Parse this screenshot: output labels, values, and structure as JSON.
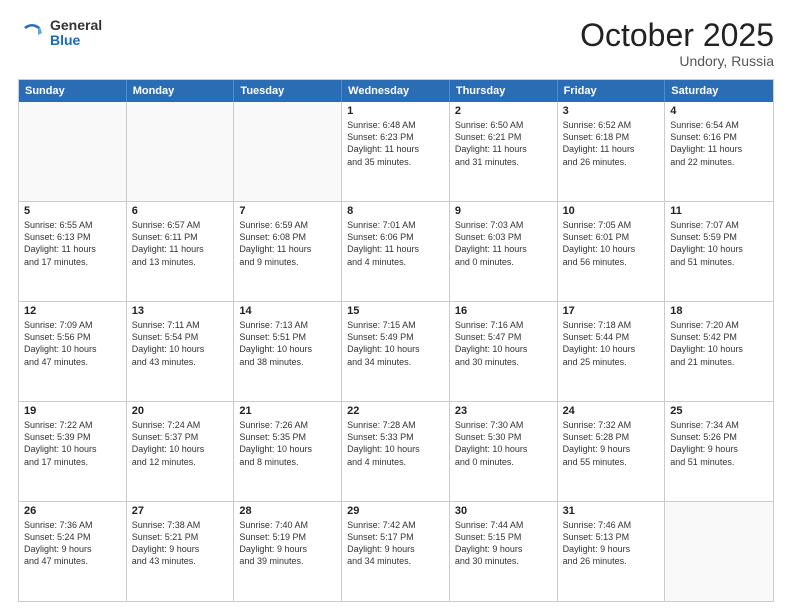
{
  "header": {
    "logo_general": "General",
    "logo_blue": "Blue",
    "month_title": "October 2025",
    "location": "Undory, Russia"
  },
  "weekdays": [
    "Sunday",
    "Monday",
    "Tuesday",
    "Wednesday",
    "Thursday",
    "Friday",
    "Saturday"
  ],
  "weeks": [
    [
      {
        "day": "",
        "text": ""
      },
      {
        "day": "",
        "text": ""
      },
      {
        "day": "",
        "text": ""
      },
      {
        "day": "1",
        "text": "Sunrise: 6:48 AM\nSunset: 6:23 PM\nDaylight: 11 hours\nand 35 minutes."
      },
      {
        "day": "2",
        "text": "Sunrise: 6:50 AM\nSunset: 6:21 PM\nDaylight: 11 hours\nand 31 minutes."
      },
      {
        "day": "3",
        "text": "Sunrise: 6:52 AM\nSunset: 6:18 PM\nDaylight: 11 hours\nand 26 minutes."
      },
      {
        "day": "4",
        "text": "Sunrise: 6:54 AM\nSunset: 6:16 PM\nDaylight: 11 hours\nand 22 minutes."
      }
    ],
    [
      {
        "day": "5",
        "text": "Sunrise: 6:55 AM\nSunset: 6:13 PM\nDaylight: 11 hours\nand 17 minutes."
      },
      {
        "day": "6",
        "text": "Sunrise: 6:57 AM\nSunset: 6:11 PM\nDaylight: 11 hours\nand 13 minutes."
      },
      {
        "day": "7",
        "text": "Sunrise: 6:59 AM\nSunset: 6:08 PM\nDaylight: 11 hours\nand 9 minutes."
      },
      {
        "day": "8",
        "text": "Sunrise: 7:01 AM\nSunset: 6:06 PM\nDaylight: 11 hours\nand 4 minutes."
      },
      {
        "day": "9",
        "text": "Sunrise: 7:03 AM\nSunset: 6:03 PM\nDaylight: 11 hours\nand 0 minutes."
      },
      {
        "day": "10",
        "text": "Sunrise: 7:05 AM\nSunset: 6:01 PM\nDaylight: 10 hours\nand 56 minutes."
      },
      {
        "day": "11",
        "text": "Sunrise: 7:07 AM\nSunset: 5:59 PM\nDaylight: 10 hours\nand 51 minutes."
      }
    ],
    [
      {
        "day": "12",
        "text": "Sunrise: 7:09 AM\nSunset: 5:56 PM\nDaylight: 10 hours\nand 47 minutes."
      },
      {
        "day": "13",
        "text": "Sunrise: 7:11 AM\nSunset: 5:54 PM\nDaylight: 10 hours\nand 43 minutes."
      },
      {
        "day": "14",
        "text": "Sunrise: 7:13 AM\nSunset: 5:51 PM\nDaylight: 10 hours\nand 38 minutes."
      },
      {
        "day": "15",
        "text": "Sunrise: 7:15 AM\nSunset: 5:49 PM\nDaylight: 10 hours\nand 34 minutes."
      },
      {
        "day": "16",
        "text": "Sunrise: 7:16 AM\nSunset: 5:47 PM\nDaylight: 10 hours\nand 30 minutes."
      },
      {
        "day": "17",
        "text": "Sunrise: 7:18 AM\nSunset: 5:44 PM\nDaylight: 10 hours\nand 25 minutes."
      },
      {
        "day": "18",
        "text": "Sunrise: 7:20 AM\nSunset: 5:42 PM\nDaylight: 10 hours\nand 21 minutes."
      }
    ],
    [
      {
        "day": "19",
        "text": "Sunrise: 7:22 AM\nSunset: 5:39 PM\nDaylight: 10 hours\nand 17 minutes."
      },
      {
        "day": "20",
        "text": "Sunrise: 7:24 AM\nSunset: 5:37 PM\nDaylight: 10 hours\nand 12 minutes."
      },
      {
        "day": "21",
        "text": "Sunrise: 7:26 AM\nSunset: 5:35 PM\nDaylight: 10 hours\nand 8 minutes."
      },
      {
        "day": "22",
        "text": "Sunrise: 7:28 AM\nSunset: 5:33 PM\nDaylight: 10 hours\nand 4 minutes."
      },
      {
        "day": "23",
        "text": "Sunrise: 7:30 AM\nSunset: 5:30 PM\nDaylight: 10 hours\nand 0 minutes."
      },
      {
        "day": "24",
        "text": "Sunrise: 7:32 AM\nSunset: 5:28 PM\nDaylight: 9 hours\nand 55 minutes."
      },
      {
        "day": "25",
        "text": "Sunrise: 7:34 AM\nSunset: 5:26 PM\nDaylight: 9 hours\nand 51 minutes."
      }
    ],
    [
      {
        "day": "26",
        "text": "Sunrise: 7:36 AM\nSunset: 5:24 PM\nDaylight: 9 hours\nand 47 minutes."
      },
      {
        "day": "27",
        "text": "Sunrise: 7:38 AM\nSunset: 5:21 PM\nDaylight: 9 hours\nand 43 minutes."
      },
      {
        "day": "28",
        "text": "Sunrise: 7:40 AM\nSunset: 5:19 PM\nDaylight: 9 hours\nand 39 minutes."
      },
      {
        "day": "29",
        "text": "Sunrise: 7:42 AM\nSunset: 5:17 PM\nDaylight: 9 hours\nand 34 minutes."
      },
      {
        "day": "30",
        "text": "Sunrise: 7:44 AM\nSunset: 5:15 PM\nDaylight: 9 hours\nand 30 minutes."
      },
      {
        "day": "31",
        "text": "Sunrise: 7:46 AM\nSunset: 5:13 PM\nDaylight: 9 hours\nand 26 minutes."
      },
      {
        "day": "",
        "text": ""
      }
    ]
  ]
}
